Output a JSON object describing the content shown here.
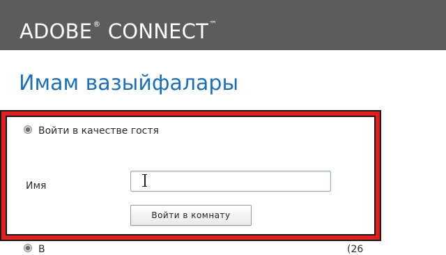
{
  "header": {
    "brand_part1": "ADOBE",
    "brand_mark1": "®",
    "brand_part2": " CONNECT",
    "brand_mark2": "™"
  },
  "page": {
    "title": "Имам вазыйфалары"
  },
  "login": {
    "guest_option_label": "Войти в качестве гостя",
    "guest_selected": true,
    "name_label": "Имя",
    "name_value": "",
    "enter_button_label": "Войти в комнату",
    "next_option_partial": "В",
    "next_option_right_partial": "(26"
  },
  "colors": {
    "header_bg": "#5c5c5c",
    "title": "#1f6fb2",
    "highlight_border": "#e0201f"
  },
  "icons": {
    "text_cursor": "i-beam-cursor-icon"
  }
}
